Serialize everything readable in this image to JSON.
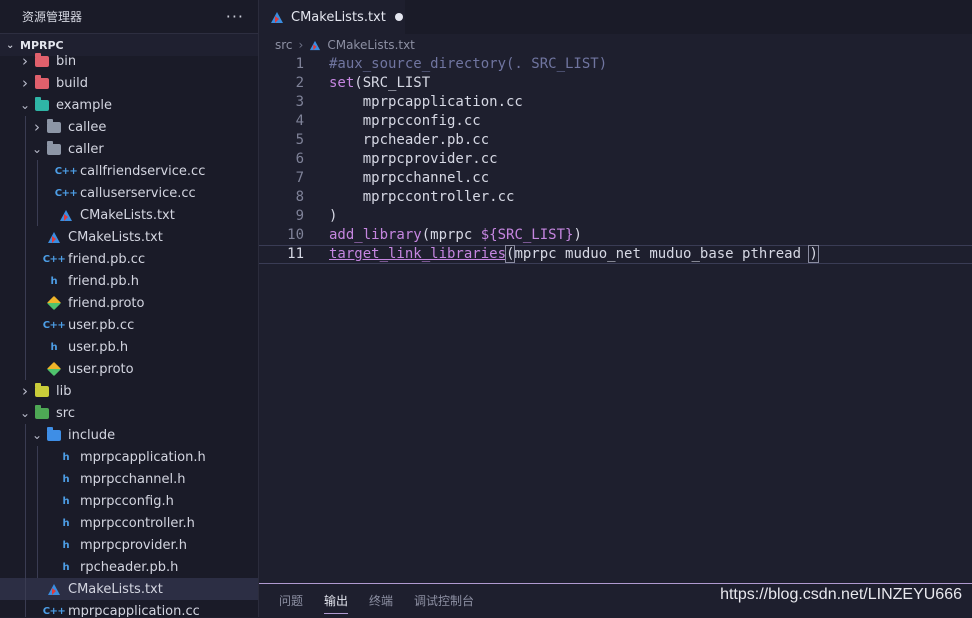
{
  "sidebar": {
    "title": "资源管理器",
    "more_label": "···",
    "section": "MPRPC",
    "items": [
      {
        "label": "bin",
        "kind": "folder",
        "color": "#e0606c",
        "expanded": false,
        "depth": 0
      },
      {
        "label": "build",
        "kind": "folder",
        "color": "#e0606c",
        "expanded": false,
        "depth": 0
      },
      {
        "label": "example",
        "kind": "folder",
        "color": "#2fb5a6",
        "expanded": true,
        "depth": 0
      },
      {
        "label": "callee",
        "kind": "folder",
        "color": "#8d96a6",
        "expanded": false,
        "depth": 1
      },
      {
        "label": "caller",
        "kind": "folder-open",
        "color": "#8d96a6",
        "expanded": true,
        "depth": 1
      },
      {
        "label": "callfriendservice.cc",
        "kind": "cpp",
        "depth": 2
      },
      {
        "label": "calluserservice.cc",
        "kind": "cpp",
        "depth": 2
      },
      {
        "label": "CMakeLists.txt",
        "kind": "cmake",
        "depth": 2
      },
      {
        "label": "CMakeLists.txt",
        "kind": "cmake",
        "depth": 1
      },
      {
        "label": "friend.pb.cc",
        "kind": "cpp",
        "depth": 1
      },
      {
        "label": "friend.pb.h",
        "kind": "h",
        "depth": 1
      },
      {
        "label": "friend.proto",
        "kind": "proto",
        "depth": 1
      },
      {
        "label": "user.pb.cc",
        "kind": "cpp",
        "depth": 1
      },
      {
        "label": "user.pb.h",
        "kind": "h",
        "depth": 1
      },
      {
        "label": "user.proto",
        "kind": "proto",
        "depth": 1
      },
      {
        "label": "lib",
        "kind": "folder",
        "color": "#c9cc3a",
        "expanded": false,
        "depth": 0
      },
      {
        "label": "src",
        "kind": "folder",
        "color": "#4ea855",
        "expanded": true,
        "depth": 0
      },
      {
        "label": "include",
        "kind": "folder",
        "color": "#3e8ee6",
        "expanded": true,
        "depth": 1
      },
      {
        "label": "mprpcapplication.h",
        "kind": "h",
        "depth": 2
      },
      {
        "label": "mprpcchannel.h",
        "kind": "h",
        "depth": 2
      },
      {
        "label": "mprpcconfig.h",
        "kind": "h",
        "depth": 2
      },
      {
        "label": "mprpccontroller.h",
        "kind": "h",
        "depth": 2
      },
      {
        "label": "mprpcprovider.h",
        "kind": "h",
        "depth": 2
      },
      {
        "label": "rpcheader.pb.h",
        "kind": "h",
        "depth": 2
      },
      {
        "label": "CMakeLists.txt",
        "kind": "cmake",
        "depth": 1,
        "selected": true
      },
      {
        "label": "mprpcapplication.cc",
        "kind": "cpp",
        "depth": 1
      }
    ]
  },
  "tab": {
    "label": "CMakeLists.txt",
    "modified": true
  },
  "breadcrumb": {
    "folder": "src",
    "file": "CMakeLists.txt"
  },
  "editor": {
    "lines": [
      {
        "n": "1",
        "parts": [
          {
            "t": "#aux_source_directory(. SRC_LIST)",
            "c": "c-comment"
          }
        ]
      },
      {
        "n": "2",
        "parts": [
          {
            "t": "set",
            "c": "c-fn"
          },
          {
            "t": "(SRC_LIST",
            "c": ""
          }
        ]
      },
      {
        "n": "3",
        "parts": [
          {
            "t": "    mprpcapplication.cc",
            "c": ""
          }
        ]
      },
      {
        "n": "4",
        "parts": [
          {
            "t": "    mprpcconfig.cc",
            "c": ""
          }
        ]
      },
      {
        "n": "5",
        "parts": [
          {
            "t": "    rpcheader.pb.cc",
            "c": ""
          }
        ]
      },
      {
        "n": "6",
        "parts": [
          {
            "t": "    mprpcprovider.cc",
            "c": ""
          }
        ]
      },
      {
        "n": "7",
        "parts": [
          {
            "t": "    mprpcchannel.cc",
            "c": ""
          }
        ]
      },
      {
        "n": "8",
        "parts": [
          {
            "t": "    mprpccontroller.cc",
            "c": ""
          }
        ]
      },
      {
        "n": "9",
        "parts": [
          {
            "t": ")",
            "c": ""
          }
        ]
      },
      {
        "n": "10",
        "parts": [
          {
            "t": "add_library",
            "c": "c-fn"
          },
          {
            "t": "(mprpc ",
            "c": ""
          },
          {
            "t": "${SRC_LIST}",
            "c": "c-var"
          },
          {
            "t": ")",
            "c": ""
          }
        ]
      },
      {
        "n": "11",
        "active": true,
        "parts": [
          {
            "t": "target_link_libraries",
            "c": "c-fn2"
          },
          {
            "t": "(",
            "c": "bracket"
          },
          {
            "t": "mprpc muduo_net muduo_base pthread ",
            "c": ""
          },
          {
            "t": ")",
            "c": "bracket"
          }
        ]
      }
    ]
  },
  "panel": {
    "tabs": [
      {
        "label": "问题",
        "active": false
      },
      {
        "label": "输出",
        "active": true
      },
      {
        "label": "终端",
        "active": false
      },
      {
        "label": "调试控制台",
        "active": false
      }
    ]
  },
  "watermark": "https://blog.csdn.net/LINZEYU666"
}
